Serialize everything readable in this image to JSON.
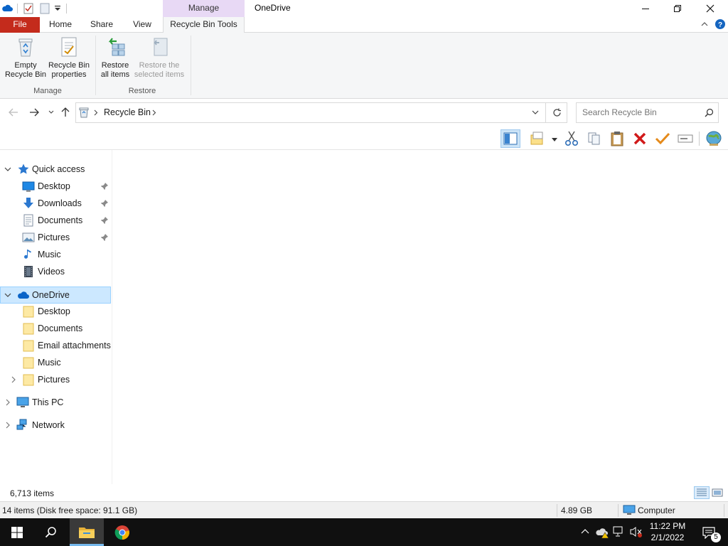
{
  "titlebar": {
    "context_tab": "Manage",
    "window_title": "OneDrive"
  },
  "tabs": {
    "file": "File",
    "home": "Home",
    "share": "Share",
    "view": "View",
    "recycle_bin_tools": "Recycle Bin Tools"
  },
  "ribbon": {
    "empty_line1": "Empty",
    "empty_line2": "Recycle Bin",
    "props_line1": "Recycle Bin",
    "props_line2": "properties",
    "manage_group": "Manage",
    "restore_all_line1": "Restore",
    "restore_all_line2": "all items",
    "restore_sel_line1": "Restore the",
    "restore_sel_line2": "selected items",
    "restore_group": "Restore"
  },
  "address": {
    "location": "Recycle Bin",
    "search_placeholder": "Search Recycle Bin"
  },
  "nav": {
    "quick_access": "Quick access",
    "qa_items": [
      "Desktop",
      "Downloads",
      "Documents",
      "Pictures",
      "Music",
      "Videos"
    ],
    "onedrive": "OneDrive",
    "od_items": [
      "Desktop",
      "Documents",
      "Email attachments",
      "Music",
      "Pictures"
    ],
    "this_pc": "This PC",
    "network": "Network"
  },
  "status": {
    "item_count": "6,713 items",
    "summary": "14 items (Disk free space: 91.1 GB)",
    "size": "4.89 GB",
    "location": "Computer"
  },
  "taskbar": {
    "time": "11:22 PM",
    "date": "2/1/2022",
    "notification_count": "5"
  },
  "colors": {
    "file_tab": "#c42b1c",
    "context_tab": "#e8d9f5",
    "selection": "#cce8ff",
    "accent": "#0078d7"
  }
}
